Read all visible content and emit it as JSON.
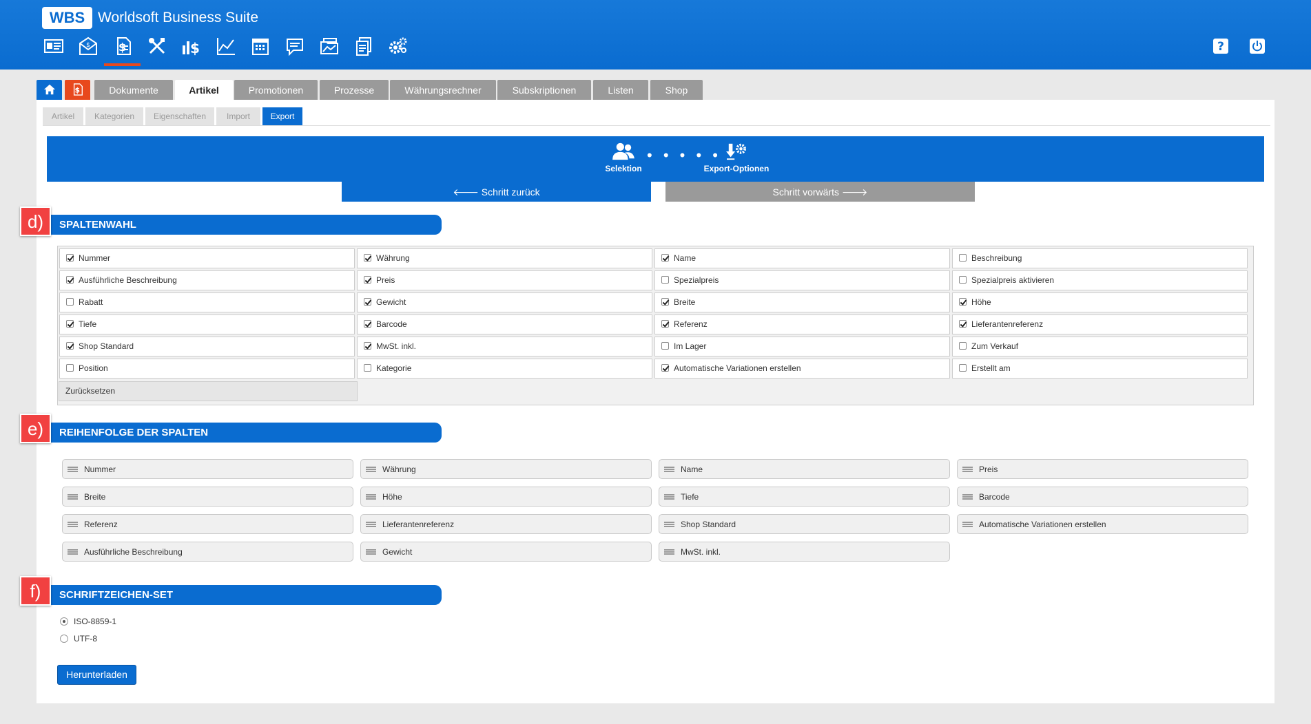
{
  "header": {
    "logo": "WBS",
    "app_title": "Worldsoft Business Suite",
    "nav_icons": [
      "contacts-card-icon",
      "mail-icon",
      "document-dollar-icon",
      "tools-icon",
      "finance-icon",
      "chart-icon",
      "calendar-icon",
      "chat-icon",
      "folders-icon",
      "documents-icon",
      "settings-gears-icon"
    ],
    "help_icon": "help-icon",
    "power_icon": "power-icon"
  },
  "tabs": [
    {
      "label": "Dokumente"
    },
    {
      "label": "Artikel"
    },
    {
      "label": "Promotionen"
    },
    {
      "label": "Prozesse"
    },
    {
      "label": "Währungsrechner"
    },
    {
      "label": "Subskriptionen"
    },
    {
      "label": "Listen"
    },
    {
      "label": "Shop"
    }
  ],
  "subtabs": [
    {
      "label": "Artikel"
    },
    {
      "label": "Kategorien"
    },
    {
      "label": "Eigenschaften"
    },
    {
      "label": "Import"
    },
    {
      "label": "Export"
    }
  ],
  "wizard": {
    "step1": "Selektion",
    "step2": "Export-Optionen",
    "dots": "• • • • •",
    "back": "🡐 Schritt zurück",
    "forward": "Schritt vorwärts 🡒"
  },
  "sections": {
    "d_letter": "d)",
    "d_title": "SPALTENWAHL",
    "e_letter": "e)",
    "e_title": "REIHENFOLGE DER SPALTEN",
    "f_letter": "f)",
    "f_title": "SCHRIFTZEICHEN-SET"
  },
  "columns": [
    {
      "label": "Nummer",
      "checked": true
    },
    {
      "label": "Währung",
      "checked": true
    },
    {
      "label": "Name",
      "checked": true
    },
    {
      "label": "Beschreibung",
      "checked": false
    },
    {
      "label": "Ausführliche Beschreibung",
      "checked": true
    },
    {
      "label": "Preis",
      "checked": true
    },
    {
      "label": "Spezialpreis",
      "checked": false
    },
    {
      "label": "Spezialpreis aktivieren",
      "checked": false
    },
    {
      "label": "Rabatt",
      "checked": false
    },
    {
      "label": "Gewicht",
      "checked": true
    },
    {
      "label": "Breite",
      "checked": true
    },
    {
      "label": "Höhe",
      "checked": true
    },
    {
      "label": "Tiefe",
      "checked": true
    },
    {
      "label": "Barcode",
      "checked": true
    },
    {
      "label": "Referenz",
      "checked": true
    },
    {
      "label": "Lieferantenreferenz",
      "checked": true
    },
    {
      "label": "Shop Standard",
      "checked": true
    },
    {
      "label": "MwSt. inkl.",
      "checked": true
    },
    {
      "label": "Im Lager",
      "checked": false
    },
    {
      "label": "Zum Verkauf",
      "checked": false
    },
    {
      "label": "Position",
      "checked": false
    },
    {
      "label": "Kategorie",
      "checked": false
    },
    {
      "label": "Automatische Variationen erstellen",
      "checked": true
    },
    {
      "label": "Erstellt am",
      "checked": false
    }
  ],
  "reset_label": "Zurücksetzen",
  "order": [
    "Nummer",
    "Währung",
    "Name",
    "Preis",
    "Breite",
    "Höhe",
    "Tiefe",
    "Barcode",
    "Referenz",
    "Lieferantenreferenz",
    "Shop Standard",
    "Automatische Variationen erstellen",
    "Ausführliche Beschreibung",
    "Gewicht",
    "MwSt. inkl."
  ],
  "charset": [
    {
      "label": "ISO-8859-1",
      "selected": true
    },
    {
      "label": "UTF-8",
      "selected": false
    }
  ],
  "download_label": "Herunterladen"
}
